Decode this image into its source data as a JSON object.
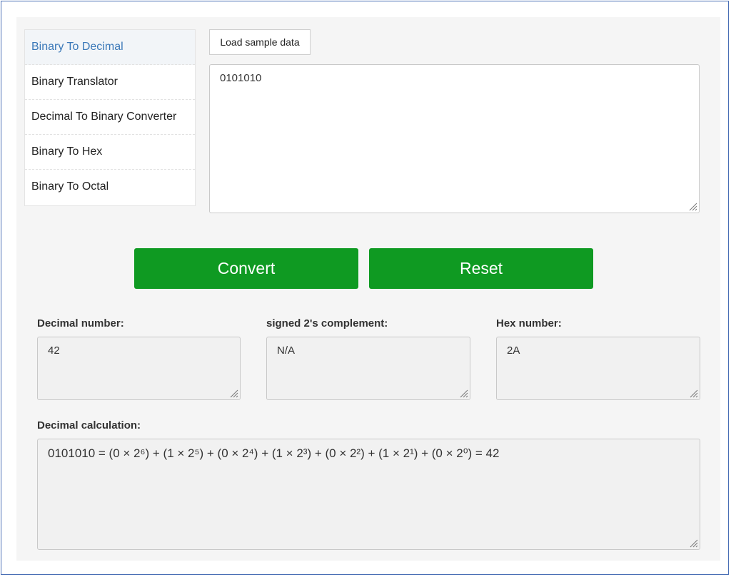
{
  "sidebar": {
    "items": [
      {
        "label": "Binary To Decimal",
        "active": true
      },
      {
        "label": "Binary Translator",
        "active": false
      },
      {
        "label": "Decimal To Binary Converter",
        "active": false
      },
      {
        "label": "Binary To Hex",
        "active": false
      },
      {
        "label": "Binary To Octal",
        "active": false
      }
    ]
  },
  "toolbar": {
    "sample_label": "Load sample data"
  },
  "input": {
    "value": "0101010"
  },
  "actions": {
    "convert_label": "Convert",
    "reset_label": "Reset"
  },
  "outputs": {
    "decimal": {
      "label": "Decimal number:",
      "value": "42"
    },
    "signed": {
      "label": "signed 2's complement:",
      "value": "N/A"
    },
    "hex": {
      "label": "Hex number:",
      "value": "2A"
    },
    "calculation": {
      "label": "Decimal calculation:",
      "value": "0101010 = (0 × 2⁶) + (1 × 2⁵) + (0 × 2⁴) + (1 × 2³) + (0 × 2²) + (1 × 2¹) + (0 × 2⁰) = 42"
    }
  },
  "colors": {
    "accent_green": "#0f9a22",
    "active_link": "#3a78b8",
    "frame_border": "#4a6fb5"
  }
}
